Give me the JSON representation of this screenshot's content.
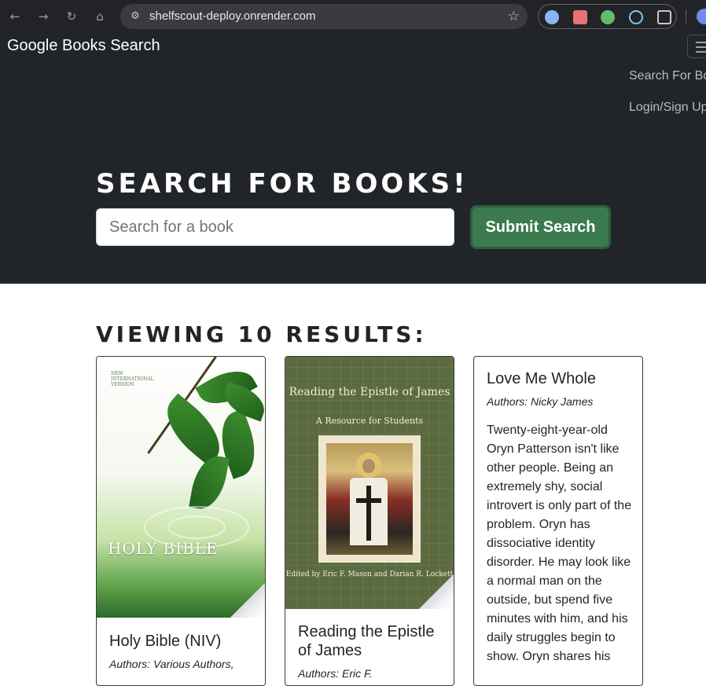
{
  "browser": {
    "url": "shelfscout-deploy.onrender.com",
    "icons": {
      "back": "arrow-left-icon",
      "forward": "arrow-right-icon",
      "reload": "reload-icon",
      "home": "home-icon",
      "site_info": "tune-icon",
      "bookmark": "star-icon"
    },
    "extension_colors": [
      "#8ab4f8",
      "#e57373",
      "#66bb6a",
      "#7fc4f5"
    ]
  },
  "navbar": {
    "brand": "Google Books Search",
    "links": [
      "Search For Books",
      "Login/Sign Up"
    ]
  },
  "hero": {
    "title": "Search for Books!",
    "search_placeholder": "Search for a book",
    "submit_label": "Submit Search"
  },
  "results": {
    "heading": "Viewing 10 results:",
    "books": [
      {
        "title": "Holy Bible (NIV)",
        "authors": "Authors: Various Authors,",
        "cover_text": [
          "NEW INTERNATIONAL VERSION",
          "HOLY BIBLE"
        ]
      },
      {
        "title": "Reading the Epistle of James",
        "authors": "Authors: Eric F.",
        "cover_text": [
          "Reading the Epistle of James",
          "A Resource for Students",
          "Edited by Eric F. Mason and Darian R. Lockett"
        ]
      },
      {
        "title": "Love Me Whole",
        "authors": "Authors: Nicky James",
        "description": "Twenty-eight-year-old Oryn Patterson isn't like other people. Being an extremely shy, social introvert is only part of the problem. Oryn has dissociative identity disorder. He may look like a normal man on the outside, but spend five minutes with him, and his daily struggles begin to show. Oryn shares his"
      }
    ]
  },
  "colors": {
    "header_bg": "#212529",
    "submit_bg": "#3b7a4f",
    "chrome_bg": "#222326"
  }
}
